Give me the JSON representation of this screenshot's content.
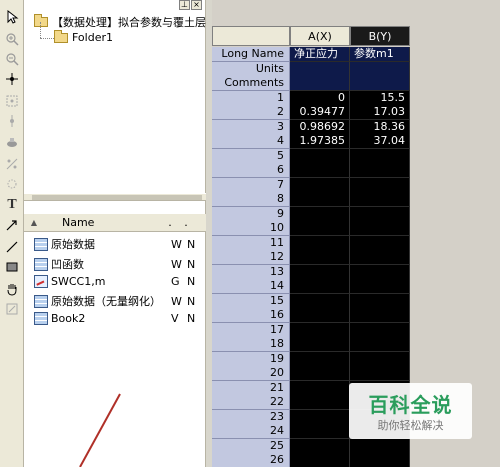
{
  "toolbar": {
    "tools": [
      "pointer-icon",
      "zoom-in-icon",
      "zoom-out-icon",
      "data-reader-icon",
      "screen-reader-icon",
      "data-selector-icon",
      "mask-icon",
      "scale-icon",
      "region-icon",
      "text-icon",
      "arrow-icon",
      "line-icon",
      "rectangle-icon",
      "pan-hand-icon",
      "button-icon"
    ],
    "text_tool_label": "T"
  },
  "explorer": {
    "window_controls": {
      "pin": "⊥",
      "close": "×"
    },
    "root_folder": "【数据处理】拟合参数与覆土层",
    "subfolder": "Folder1",
    "list_header": {
      "sort_arrow": "▲",
      "name": "Name",
      "col1": ".",
      "col2": "."
    },
    "items": [
      {
        "name": "原始数据",
        "c1": "W",
        "c2": "N",
        "icon": "workbook-icon"
      },
      {
        "name": "凹函数",
        "c1": "W",
        "c2": "N",
        "icon": "workbook-icon"
      },
      {
        "name": "SWCC1,m",
        "c1": "G",
        "c2": "N",
        "icon": "graph-icon"
      },
      {
        "name": "原始数据（无量纲化）",
        "c1": "W",
        "c2": "N",
        "icon": "workbook-icon"
      },
      {
        "name": "Book2",
        "c1": "V",
        "c2": "N",
        "icon": "workbook-icon"
      }
    ]
  },
  "sheet": {
    "columns": [
      "A(X)",
      "B(Y)"
    ],
    "header_rows": [
      {
        "label": "Long Name",
        "a": "净正应力",
        "b": "参数m1"
      },
      {
        "label": "Units",
        "a": "",
        "b": ""
      },
      {
        "label": "Comments",
        "a": "",
        "b": ""
      }
    ],
    "rows": [
      {
        "n": "1",
        "a": "0",
        "b": "15.5"
      },
      {
        "n": "2",
        "a": "0.39477",
        "b": "17.03"
      },
      {
        "n": "3",
        "a": "0.98692",
        "b": "18.36"
      },
      {
        "n": "4",
        "a": "1.97385",
        "b": "37.04"
      },
      {
        "n": "5",
        "a": "",
        "b": ""
      },
      {
        "n": "6",
        "a": "",
        "b": ""
      },
      {
        "n": "7",
        "a": "",
        "b": ""
      },
      {
        "n": "8",
        "a": "",
        "b": ""
      },
      {
        "n": "9",
        "a": "",
        "b": ""
      },
      {
        "n": "10",
        "a": "",
        "b": ""
      },
      {
        "n": "11",
        "a": "",
        "b": ""
      },
      {
        "n": "12",
        "a": "",
        "b": ""
      },
      {
        "n": "13",
        "a": "",
        "b": ""
      },
      {
        "n": "14",
        "a": "",
        "b": ""
      },
      {
        "n": "15",
        "a": "",
        "b": ""
      },
      {
        "n": "16",
        "a": "",
        "b": ""
      },
      {
        "n": "17",
        "a": "",
        "b": ""
      },
      {
        "n": "18",
        "a": "",
        "b": ""
      },
      {
        "n": "19",
        "a": "",
        "b": ""
      },
      {
        "n": "20",
        "a": "",
        "b": ""
      },
      {
        "n": "21",
        "a": "",
        "b": ""
      },
      {
        "n": "22",
        "a": "",
        "b": ""
      },
      {
        "n": "23",
        "a": "",
        "b": ""
      },
      {
        "n": "24",
        "a": "",
        "b": ""
      },
      {
        "n": "25",
        "a": "",
        "b": ""
      },
      {
        "n": "26",
        "a": "",
        "b": ""
      }
    ]
  },
  "watermark": {
    "title": "百科全说",
    "subtitle": "助你轻松解决"
  },
  "colors": {
    "label_column": "#c2c8e0",
    "data_cells": "#000000",
    "selected_column_header": "#1a1a1a",
    "watermark_green": "#2a9d5c"
  }
}
